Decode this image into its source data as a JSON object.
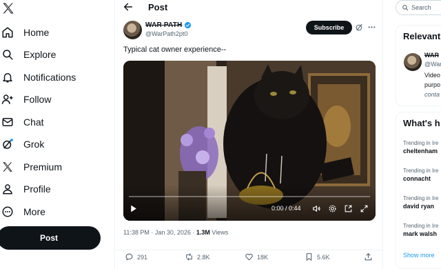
{
  "sidebar": {
    "items": [
      {
        "label": "Home",
        "icon": "home-icon"
      },
      {
        "label": "Explore",
        "icon": "search-icon"
      },
      {
        "label": "Notifications",
        "icon": "bell-icon"
      },
      {
        "label": "Follow",
        "icon": "follow-icon"
      },
      {
        "label": "Chat",
        "icon": "mail-icon"
      },
      {
        "label": "Grok",
        "icon": "grok-icon"
      },
      {
        "label": "Premium",
        "icon": "x-logo-icon"
      },
      {
        "label": "Profile",
        "icon": "person-icon"
      },
      {
        "label": "More",
        "icon": "more-circle-icon"
      }
    ],
    "post_label": "Post"
  },
  "header": {
    "title": "Post"
  },
  "tweet": {
    "author_name": "WAR PATH",
    "author_handle": "@WarPath2pt0",
    "subscribe_label": "Subscribe",
    "text": "Typical cat owner experience--",
    "video_time": "0:00 / 0:44",
    "timestamp": "11:38 PM · Jan 30, 2026 · ",
    "views_count": "1.3M",
    "views_label": " Views",
    "replies": "291",
    "reposts": "2.8K",
    "likes": "18K",
    "bookmarks": "5.6K"
  },
  "right": {
    "search_placeholder": "Search",
    "relevant_title": "Relevant",
    "rel_name": "WAR",
    "rel_handle": "@War",
    "rel_bio_1": "Video",
    "rel_bio_2": "purpo",
    "rel_bio_3": "conta",
    "whats_title": "What's h",
    "trends": [
      {
        "context": "Trending in Ire",
        "name": "cheltenham"
      },
      {
        "context": "Trending in Ire",
        "name": "connacht"
      },
      {
        "context": "Trending in Ire",
        "name": "david ryan"
      },
      {
        "context": "Trending in Ire",
        "name": "mark walsh"
      }
    ],
    "show_more": "Show more"
  },
  "colors": {
    "accent": "#1d9bf0",
    "text": "#0f1419",
    "muted": "#536471",
    "button": "#0f1419"
  }
}
